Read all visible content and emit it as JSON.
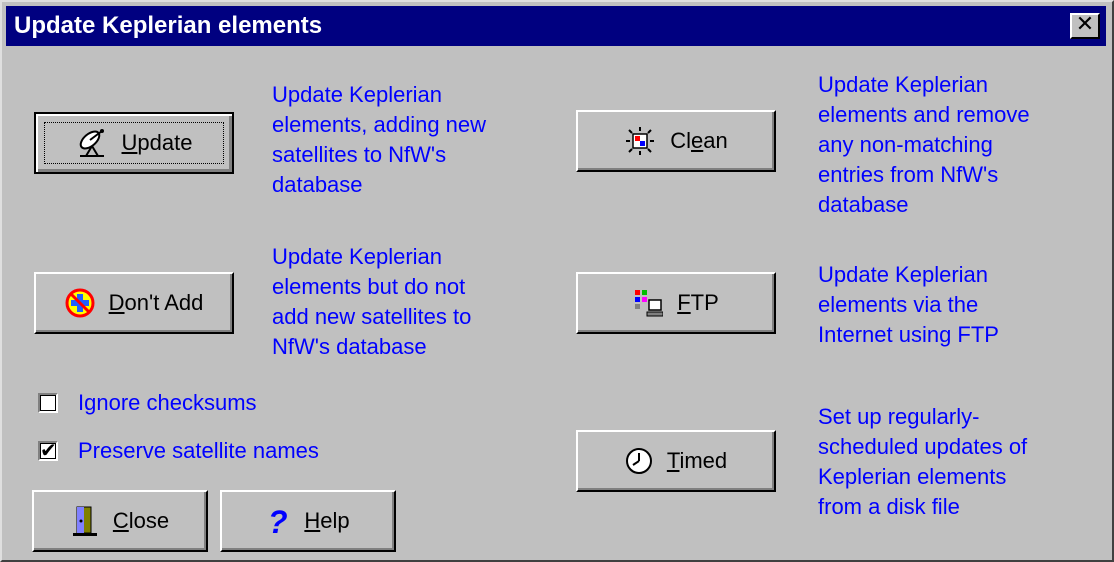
{
  "window": {
    "title": "Update Keplerian elements",
    "close_glyph": "✕"
  },
  "buttons": {
    "update": {
      "first": "U",
      "rest": "pdate",
      "icon": "satellite-dish-icon"
    },
    "dont_add": {
      "first": "D",
      "rest": "on't Add",
      "icon": "no-entry-icon"
    },
    "clean": {
      "pre": "Cl",
      "ul": "e",
      "post": "an",
      "icon": "clean-burst-icon"
    },
    "ftp": {
      "first": "F",
      "rest": "TP",
      "icon": "ftp-network-icon"
    },
    "timed": {
      "first": "T",
      "rest": "imed",
      "icon": "clock-icon"
    },
    "close": {
      "first": "C",
      "rest": "lose",
      "icon": "door-exit-icon"
    },
    "help": {
      "first": "H",
      "rest": "elp",
      "icon": "question-mark-icon"
    }
  },
  "descriptions": {
    "update": "Update Keplerian\nelements, adding new\nsatellites to NfW's\ndatabase",
    "dont_add": "Update Keplerian\nelements but do not\nadd new satellites to\nNfW's database",
    "clean": "Update Keplerian\nelements and remove\nany non-matching\nentries from NfW's\ndatabase",
    "ftp": "Update Keplerian\nelements via the\nInternet using FTP",
    "timed": "Set up regularly-\nscheduled updates of\nKeplerian elements\nfrom a disk file"
  },
  "options": {
    "ignore_checksums": {
      "label": "Ignore checksums",
      "checked": false
    },
    "preserve_names": {
      "label": "Preserve satellite names",
      "checked": true,
      "check_glyph": "✔"
    }
  },
  "colors": {
    "titlebar": "#000080",
    "dialog": "#c0c0c0",
    "description_text": "#0000ff"
  }
}
